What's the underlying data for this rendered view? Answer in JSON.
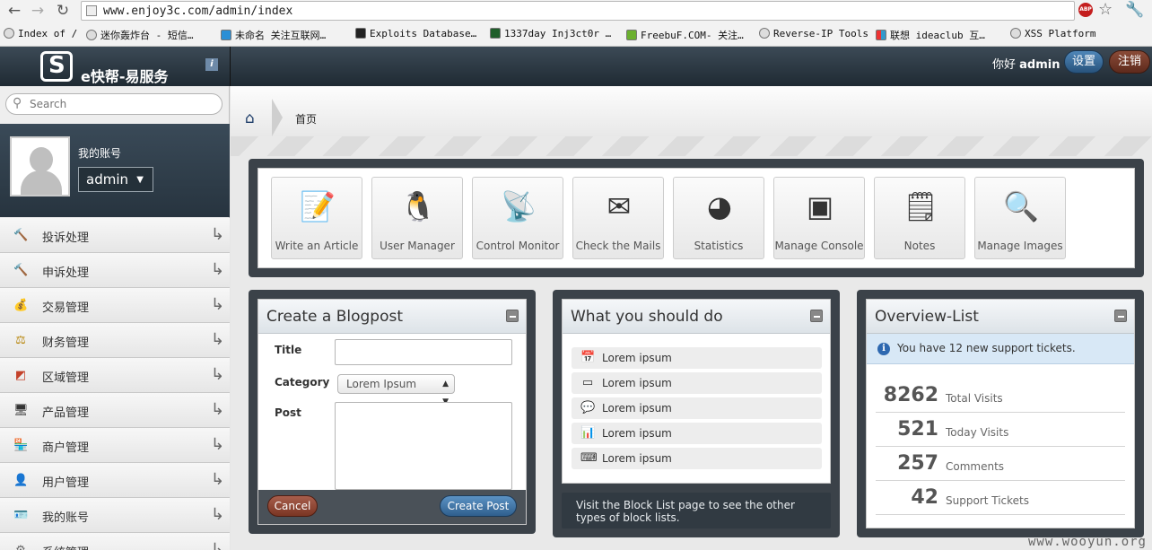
{
  "browser": {
    "url": "www.enjoy3c.com/admin/index",
    "back": "←",
    "forward": "→",
    "reload": "↻",
    "abp": "ABP",
    "bookmarks": [
      {
        "label": "Index of /"
      },
      {
        "label": "迷你轰炸台 - 短信…"
      },
      {
        "label": "未命名 关注互联网…"
      },
      {
        "label": "Exploits Database…"
      },
      {
        "label": "1337day Inj3ct0r …"
      },
      {
        "label": "FreebuF.COM- 关注…"
      },
      {
        "label": "Reverse-IP Tools"
      },
      {
        "label": "联想 ideaclub 互…"
      },
      {
        "label": "XSS Platform"
      }
    ]
  },
  "header": {
    "logo_text": "e快帮-易服务",
    "greeting": "你好",
    "username": "admin",
    "settings_label": "设置",
    "logout_label": "注销"
  },
  "sidebar": {
    "search_placeholder": "Search",
    "account_label": "我的账号",
    "account_user": "admin",
    "items": [
      {
        "label": "投诉处理",
        "icon": "gavel-icon",
        "glyph": "🔨",
        "color": "#8a3b22"
      },
      {
        "label": "申诉处理",
        "icon": "gavel-icon",
        "glyph": "🔨",
        "color": "#8a3b22"
      },
      {
        "label": "交易管理",
        "icon": "coins-icon",
        "glyph": "💰",
        "color": "#c28a1d"
      },
      {
        "label": "财务管理",
        "icon": "scales-icon",
        "glyph": "⚖",
        "color": "#b8860b"
      },
      {
        "label": "区域管理",
        "icon": "map-icon",
        "glyph": "◩",
        "color": "#c4422a"
      },
      {
        "label": "产品管理",
        "icon": "monitor-icon",
        "glyph": "🖥",
        "color": "#333"
      },
      {
        "label": "商户管理",
        "icon": "shop-icon",
        "glyph": "🏪",
        "color": "#c28a1d"
      },
      {
        "label": "用户管理",
        "icon": "user-icon",
        "glyph": "👤",
        "color": "#b0744a"
      },
      {
        "label": "我的账号",
        "icon": "id-card-icon",
        "glyph": "🪪",
        "color": "#4a6d92"
      },
      {
        "label": "系统管理",
        "icon": "settings-icon",
        "glyph": "⚙",
        "color": "#666"
      }
    ]
  },
  "breadcrumb": {
    "home": "⌂",
    "current": "首页"
  },
  "shortcuts": [
    {
      "label": "Write an Article",
      "icon": "notepad-pen-icon",
      "glyph": "📝"
    },
    {
      "label": "User Manager",
      "icon": "penguin-icon",
      "glyph": "🐧"
    },
    {
      "label": "Control Monitor",
      "icon": "radar-icon",
      "glyph": "📡"
    },
    {
      "label": "Check the Mails",
      "icon": "mail-clock-icon",
      "glyph": "✉"
    },
    {
      "label": "Statistics",
      "icon": "pie-chart-icon",
      "glyph": "◕"
    },
    {
      "label": "Manage Console",
      "icon": "terminal-icon",
      "glyph": "▣"
    },
    {
      "label": "Notes",
      "icon": "sticky-note-icon",
      "glyph": "🗒"
    },
    {
      "label": "Manage Images",
      "icon": "magnifier-image-icon",
      "glyph": "🔍"
    }
  ],
  "blogpost": {
    "title": "Create a Blogpost",
    "title_label": "Title",
    "title_value": "",
    "category_label": "Category",
    "category_value": "Lorem Ipsum",
    "post_label": "Post",
    "post_value": "",
    "cancel_label": "Cancel",
    "submit_label": "Create Post"
  },
  "todo": {
    "title": "What you should do",
    "items": [
      {
        "label": "Lorem ipsum",
        "icon": "calendar-icon",
        "glyph": "📅"
      },
      {
        "label": "Lorem ipsum",
        "icon": "window-icon",
        "glyph": "▭"
      },
      {
        "label": "Lorem ipsum",
        "icon": "speech-bubble-icon",
        "glyph": "💬"
      },
      {
        "label": "Lorem ipsum",
        "icon": "bar-chart-icon",
        "glyph": "📊"
      },
      {
        "label": "Lorem ipsum",
        "icon": "keyboard-icon",
        "glyph": "⌨"
      }
    ],
    "note": "Visit the Block List page to see the other types of block lists."
  },
  "overview": {
    "title": "Overview-List",
    "info_icon": "i",
    "info": "You have 12 new support tickets.",
    "stats": [
      {
        "value": "8262",
        "label": "Total Visits"
      },
      {
        "value": "521",
        "label": "Today Visits"
      },
      {
        "value": "257",
        "label": "Comments"
      },
      {
        "value": "42",
        "label": "Support Tickets"
      }
    ]
  },
  "watermark": "www.wooyun.org",
  "colors": {
    "header_dark": "#27343f",
    "accent_blue": "#2f5f8d",
    "accent_red": "#7a3523",
    "panel_dark": "#3b4249"
  }
}
